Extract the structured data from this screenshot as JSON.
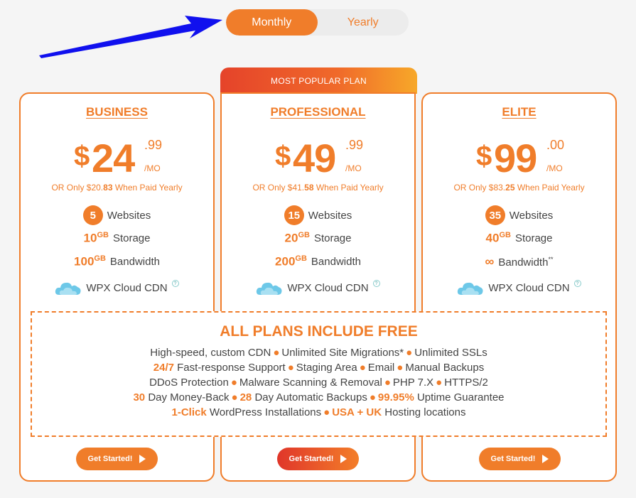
{
  "toggle": {
    "monthly": "Monthly",
    "yearly": "Yearly"
  },
  "popular_banner": "MOST POPULAR PLAN",
  "plans": [
    {
      "name": "BUSINESS",
      "dollar": "$",
      "amount": "24",
      "cents": ".99",
      "per": "/MO",
      "yearly_pre": "OR Only $20.",
      "yearly_bold": "83",
      "yearly_post": " When Paid Yearly",
      "websites": "5",
      "websites_label": "Websites",
      "storage": "10",
      "storage_unit": "GB",
      "storage_label": "Storage",
      "bandwidth": "100",
      "bandwidth_unit": "GB",
      "bandwidth_label": "Bandwidth",
      "cdn_label": "WPX Cloud CDN",
      "cta": "Get Started!"
    },
    {
      "name": "PROFESSIONAL",
      "dollar": "$",
      "amount": "49",
      "cents": ".99",
      "per": "/MO",
      "yearly_pre": "OR Only $41.",
      "yearly_bold": "58",
      "yearly_post": " When Paid Yearly",
      "websites": "15",
      "websites_label": "Websites",
      "storage": "20",
      "storage_unit": "GB",
      "storage_label": "Storage",
      "bandwidth": "200",
      "bandwidth_unit": "GB",
      "bandwidth_label": "Bandwidth",
      "cdn_label": "WPX Cloud CDN",
      "cta": "Get Started!"
    },
    {
      "name": "ELITE",
      "dollar": "$",
      "amount": "99",
      "cents": ".00",
      "per": "/MO",
      "yearly_pre": "OR Only $83.",
      "yearly_bold": "25",
      "yearly_post": " When Paid Yearly",
      "websites": "35",
      "websites_label": "Websites",
      "storage": "40",
      "storage_unit": "GB",
      "storage_label": "Storage",
      "bandwidth": "∞",
      "bandwidth_label": "Bandwidth",
      "bandwidth_sup": "**",
      "cdn_label": "WPX Cloud CDN",
      "cta": "Get Started!"
    }
  ],
  "help_glyph": "?",
  "all_plans": {
    "title": "ALL PLANS INCLUDE FREE",
    "line1": {
      "a": "High-speed, custom CDN",
      "b": "Unlimited Site Migrations*",
      "c": "Unlimited SSLs"
    },
    "line2": {
      "a_bold": "24/7",
      "a": " Fast-response Support",
      "b": "Staging Area",
      "c": "Email",
      "d": "Manual Backups"
    },
    "line3": {
      "a": "DDoS Protection",
      "b": "Malware Scanning & Removal",
      "c": "PHP 7.X",
      "d": "HTTPS/2"
    },
    "line4": {
      "a_bold": "30",
      "a": " Day Money-Back",
      "b_bold": "28",
      "b": " Day Automatic Backups",
      "c_bold": "99.95%",
      "c": " Uptime Guarantee"
    },
    "line5": {
      "a_bold": "1-Click",
      "a": " WordPress Installations",
      "b_bold": "USA + UK",
      "b": " Hosting locations"
    },
    "bullet": "●"
  }
}
